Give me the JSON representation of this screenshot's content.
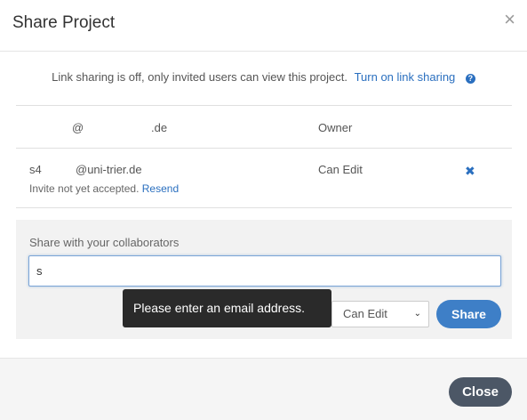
{
  "header": {
    "title": "Share Project",
    "close_symbol": "×"
  },
  "link_sharing": {
    "message": "Link sharing is off, only invited users can view this project.",
    "toggle_label": "Turn on link sharing",
    "help_symbol": "?"
  },
  "members": [
    {
      "name": "",
      "email": "@",
      "domain": ".de",
      "role": "Owner"
    },
    {
      "name": "s4",
      "email": "@uni-trier.de",
      "role": "Can Edit",
      "note": "Invite not yet accepted.",
      "resend_label": "Resend",
      "remove_symbol": "✖"
    }
  ],
  "share": {
    "label": "Share with your collaborators",
    "input_value": "s",
    "tooltip": "Please enter an email address.",
    "role_value": "Can Edit",
    "role_chevron": "⌄",
    "share_label": "Share"
  },
  "footer": {
    "close_label": "Close"
  },
  "colors": {
    "accent": "#3e7fc7",
    "link": "#2a6fbf",
    "close_button": "#4c5766"
  }
}
